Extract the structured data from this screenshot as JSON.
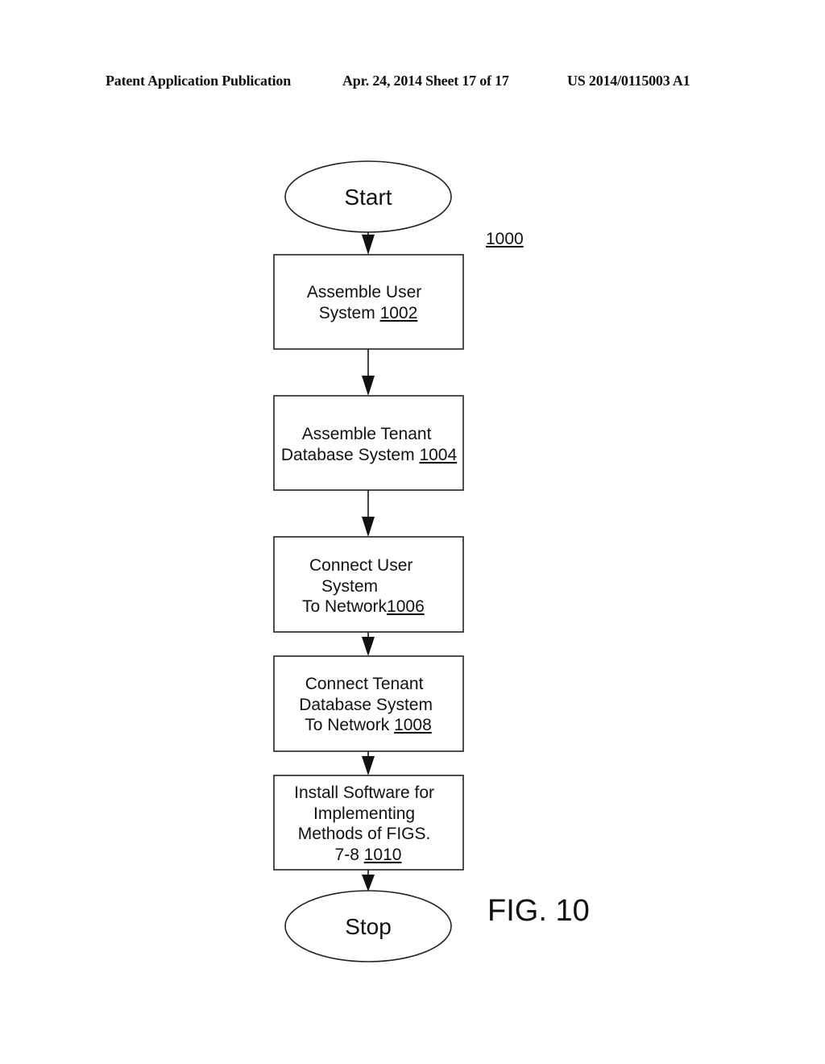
{
  "header": {
    "left": "Patent Application Publication",
    "center": "Apr. 24, 2014  Sheet 17 of 17",
    "right": "US 2014/0115003 A1"
  },
  "diagram": {
    "ref": "1000",
    "figure_label": "FIG. 10",
    "start_label": "Start",
    "stop_label": "Stop",
    "steps": [
      {
        "lines": [
          "Assemble User",
          "System "
        ],
        "ref": "1002"
      },
      {
        "lines": [
          "Assemble Tenant",
          "Database System "
        ],
        "ref": "1004"
      },
      {
        "lines": [
          "Connect User",
          "System",
          "To Network"
        ],
        "ref": "1006"
      },
      {
        "lines": [
          "Connect Tenant",
          "Database System",
          "To Network "
        ],
        "ref": "1008"
      },
      {
        "lines": [
          "Install Software for",
          "Implementing",
          "Methods of FIGS.",
          "7-8 "
        ],
        "ref": "1010"
      }
    ]
  }
}
